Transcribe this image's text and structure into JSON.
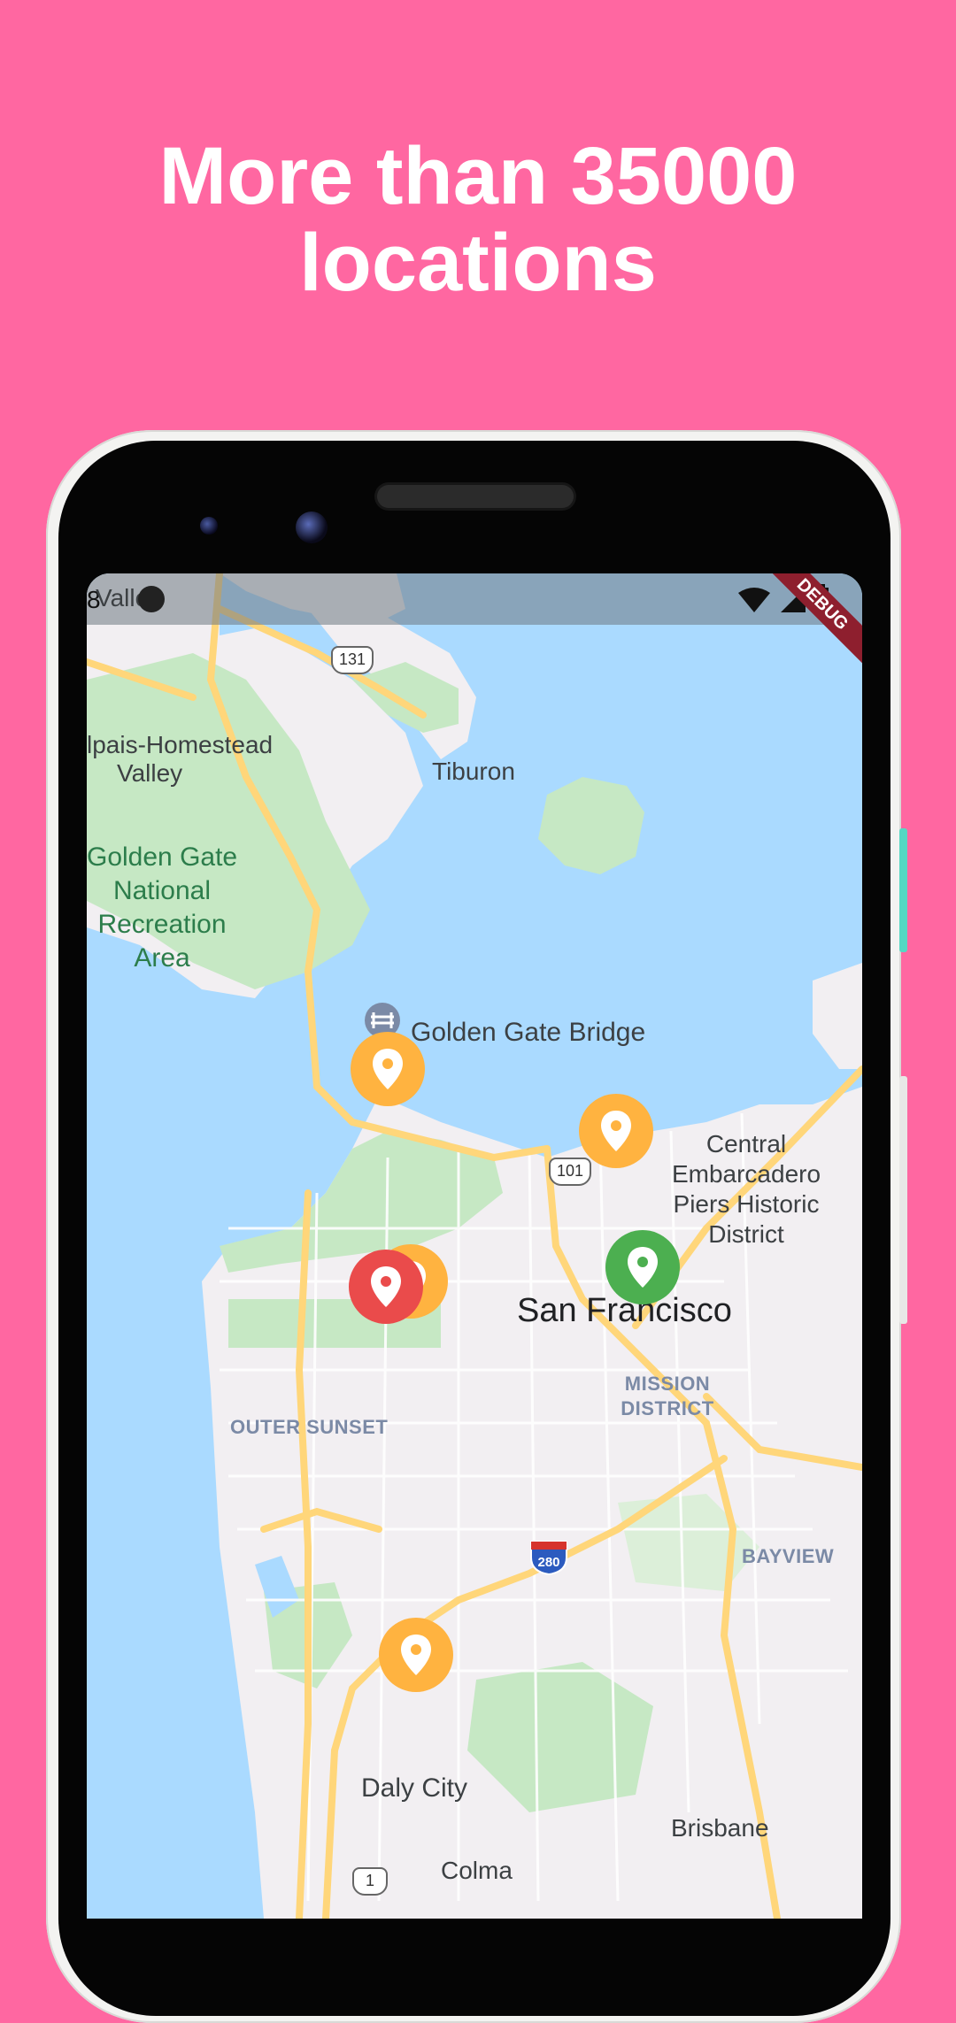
{
  "headline": {
    "line1": "More than 35000",
    "line2": "locations"
  },
  "status_bar": {
    "left_text": "8",
    "clipped_label": "Valley"
  },
  "debug_banner": {
    "label": "DEBUG"
  },
  "map": {
    "labels": {
      "tiburon": "Tiburon",
      "mill_valley_line1": "lpais-Homestead",
      "mill_valley_line2": "Valley",
      "ggnra_line1": "Golden Gate",
      "ggnra_line2": "National",
      "ggnra_line3": "Recreation",
      "ggnra_line4": "Area",
      "golden_gate_bridge": "Golden Gate Bridge",
      "embarcadero_line1": "Central",
      "embarcadero_line2": "Embarcadero",
      "embarcadero_line3": "Piers Historic",
      "embarcadero_line4": "District",
      "san_francisco": "San Francisco",
      "mission_line1": "MISSION",
      "mission_line2": "DISTRICT",
      "outer_sunset": "OUTER SUNSET",
      "bayview": "BAYVIEW",
      "daly_city": "Daly City",
      "brisbane": "Brisbane",
      "colma": "Colma"
    },
    "shields": {
      "hwy131": "131",
      "us101": "101",
      "i280": "280",
      "hwy1": "1"
    },
    "markers": [
      {
        "id": "golden-gate",
        "color": "#FFB340",
        "kind": "pin"
      },
      {
        "id": "north-beach",
        "color": "#FFB340",
        "kind": "pin"
      },
      {
        "id": "downtown",
        "color": "#4CAF50",
        "kind": "pin"
      },
      {
        "id": "park-red",
        "color": "#EA4B4B",
        "kind": "pin"
      },
      {
        "id": "park-orange",
        "color": "#FFB340",
        "kind": "pin"
      },
      {
        "id": "south",
        "color": "#FFB340",
        "kind": "pin"
      }
    ]
  },
  "colors": {
    "background": "#FF67A1",
    "water": "#aadaff",
    "land": "#f2eff2",
    "park": "#c6e8c4",
    "highway": "#ffd67a"
  }
}
